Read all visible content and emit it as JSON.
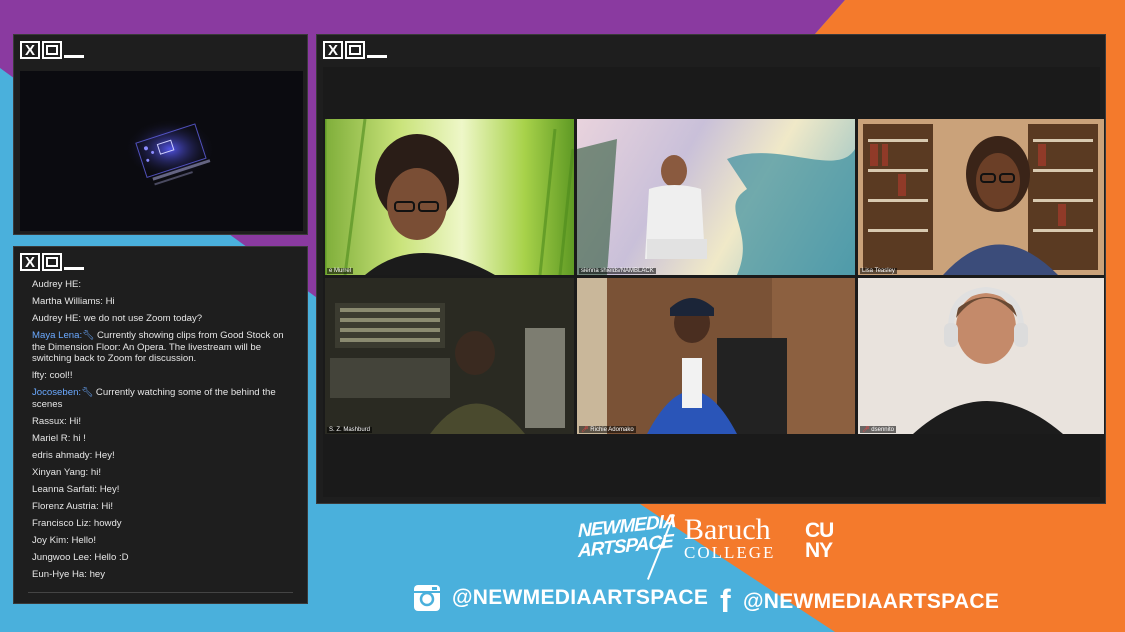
{
  "windows": {
    "close_glyph": "X"
  },
  "chat": {
    "messages": [
      {
        "user": "Audrey HE:",
        "text": "",
        "mod": false
      },
      {
        "user": "Martha Williams:",
        "text": "Hi",
        "mod": false
      },
      {
        "user": "Audrey HE:",
        "text": "we do not use Zoom today?",
        "mod": false
      },
      {
        "user": "Maya Lena:",
        "text": "Currently showing clips from Good Stock on the Dimension Floor: An Opera. The livestream will be switching back to Zoom for discussion.",
        "mod": true
      },
      {
        "user": "lfty:",
        "text": "cool!!",
        "mod": false
      },
      {
        "user": "Jocoseben:",
        "text": "Currently watching some of the behind the scenes",
        "mod": true
      },
      {
        "user": "Rassux:",
        "text": "Hi!",
        "mod": false
      },
      {
        "user": "Mariel R:",
        "text": "hi !",
        "mod": false
      },
      {
        "user": "edris ahmady:",
        "text": "Hey!",
        "mod": false
      },
      {
        "user": "Xinyan Yang:",
        "text": "hi!",
        "mod": false
      },
      {
        "user": "Leanna Sarfati:",
        "text": "Hey!",
        "mod": false
      },
      {
        "user": "Florenz Austria:",
        "text": "Hi!",
        "mod": false
      },
      {
        "user": "Francisco Liz:",
        "text": "howdy",
        "mod": false
      },
      {
        "user": "Joy Kim:",
        "text": "Hello!",
        "mod": false
      },
      {
        "user": "Jungwoo Lee:",
        "text": "Hello :D",
        "mod": false
      },
      {
        "user": "Eun-Hye Ha:",
        "text": "hey",
        "mod": false
      }
    ]
  },
  "meeting": {
    "participants": [
      {
        "name": "e Murrel",
        "muted": false
      },
      {
        "name": "sienna shields/NAMBLACK",
        "muted": false
      },
      {
        "name": "Lisa Teasley",
        "muted": false
      },
      {
        "name": "S. Z. Mashburd",
        "muted": false
      },
      {
        "name": "Richie Adomako",
        "muted": true
      },
      {
        "name": "dsennito",
        "muted": true
      }
    ]
  },
  "branding": {
    "nmas_line1": "NEWMEDIA",
    "nmas_line2": "ARTSPACE",
    "baruch_line1": "Baruch",
    "baruch_line2": "COLLEGE",
    "cuny_line1": "CU",
    "cuny_line2": "NY",
    "instagram_handle": "@NEWMEDIAARTSPACE",
    "facebook_handle": "@NEWMEDIAARTSPACE",
    "facebook_glyph": "f"
  },
  "colors": {
    "purple": "#8a3aa0",
    "orange": "#f47a2c",
    "blue": "#4ab0dc",
    "window": "#1e1e1e",
    "active_speaker": "#f0e68c"
  }
}
